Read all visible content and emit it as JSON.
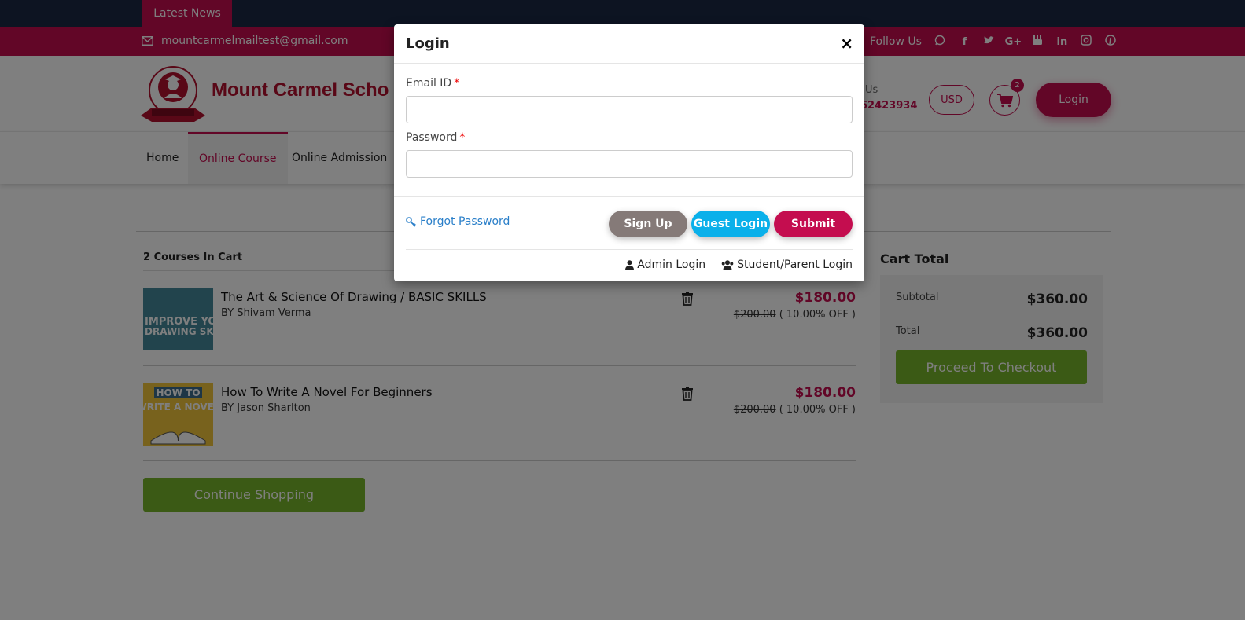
{
  "topbar": {
    "news_label": "Latest News"
  },
  "contact": {
    "email": "mountcarmelmailtest@gmail.com",
    "follow_label": "Follow Us",
    "socials": [
      "whatsapp-icon",
      "facebook-icon",
      "twitter-icon",
      "google-plus-icon",
      "youtube-icon",
      "linkedin-icon",
      "instagram-icon",
      "pinterest-icon"
    ]
  },
  "header": {
    "logo_text": "Mount Carmel Scho",
    "contact_label": "Us",
    "phone_partial": "62423934",
    "currency": "USD",
    "cart_count": "2",
    "login_label": "Login"
  },
  "nav": {
    "items": [
      {
        "label": "Home"
      },
      {
        "label": "Online Course"
      },
      {
        "label": "Online Admission"
      }
    ]
  },
  "cart": {
    "count_label": "2 Courses In Cart",
    "items": [
      {
        "title": "The Art & Science Of Drawing / BASIC SKILLS",
        "author": "BY Shivam Verma",
        "price": "$180.00",
        "old_price": "$200.00",
        "discount": "( 10.00% OFF )",
        "thumb_text_1": "IMPROVE YOU",
        "thumb_text_2": "DRAWING SKI"
      },
      {
        "title": "How To Write A Novel For Beginners",
        "author": "BY Jason Sharlton",
        "price": "$180.00",
        "old_price": "$200.00",
        "discount": "( 10.00% OFF )",
        "thumb_text_1": "HOW TO",
        "thumb_text_2": "WRITE A NOVEL"
      }
    ],
    "continue_label": "Continue Shopping"
  },
  "totals": {
    "title": "Cart Total",
    "subtotal_label": "Subtotal",
    "subtotal": "$360.00",
    "total_label": "Total",
    "total": "$360.00",
    "checkout_label": "Proceed To Checkout"
  },
  "modal": {
    "title": "Login",
    "close": "×",
    "email_label": "Email ID",
    "password_label": "Password",
    "required_mark": "*",
    "email_value": "",
    "password_value": "",
    "forgot_label": "Forgot Password",
    "signup_label": "Sign Up",
    "guest_label": "Guest Login",
    "submit_label": "Submit",
    "admin_login_label": "Admin Login",
    "student_login_label": "Student/Parent Login"
  },
  "colors": {
    "brand": "#c40d4f",
    "topbar": "#1a2945",
    "green": "#77b52b",
    "guest_blue": "#0ab0ea",
    "signup_gray": "#857a78"
  }
}
